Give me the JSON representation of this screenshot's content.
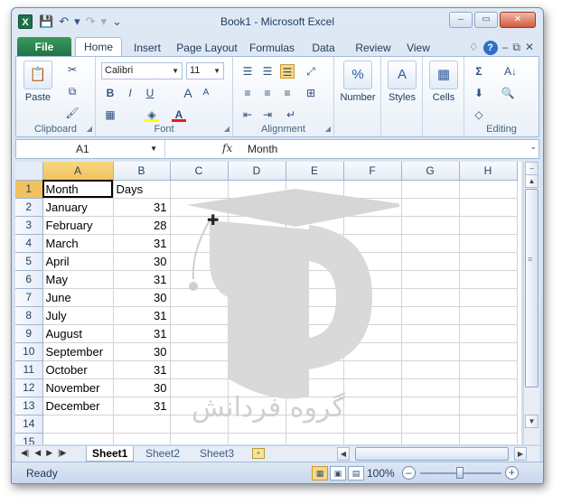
{
  "window": {
    "title": "Book1 - Microsoft Excel",
    "app_icon": "X",
    "buttons": {
      "minimize": "–",
      "restore": "▭",
      "close": "✕"
    }
  },
  "qat": {
    "save": "💾",
    "undo": "↶",
    "undo_drop": "▾",
    "redo": "↷",
    "redo_drop": "▾",
    "customize": "⌄"
  },
  "tabs": {
    "file": "File",
    "items": [
      "Home",
      "Insert",
      "Page Layout",
      "Formulas",
      "Data",
      "Review",
      "View"
    ],
    "active": "Home",
    "help": "?"
  },
  "ribbon": {
    "clipboard": {
      "label": "Clipboard",
      "paste": "Paste"
    },
    "font": {
      "label": "Font",
      "name": "Calibri",
      "size": "11",
      "bold": "B",
      "italic": "I",
      "underline": "U",
      "grow": "A",
      "shrink": "A"
    },
    "alignment": {
      "label": "Alignment"
    },
    "number": {
      "label": "Number",
      "icon": "%"
    },
    "styles": {
      "label": "Styles",
      "icon": "A"
    },
    "cells": {
      "label": "Cells",
      "icon": "▦"
    },
    "editing": {
      "label": "Editing",
      "sum": "Σ",
      "sort": "A↓",
      "find": "🔍"
    }
  },
  "formula_bar": {
    "name_box": "A1",
    "fx": "fx",
    "formula": "Month"
  },
  "grid": {
    "columns": [
      "A",
      "B",
      "C",
      "D",
      "E",
      "F",
      "G",
      "H"
    ],
    "rows": [
      [
        "Month",
        "Days"
      ],
      [
        "January",
        "31"
      ],
      [
        "February",
        "28"
      ],
      [
        "March",
        "31"
      ],
      [
        "April",
        "30"
      ],
      [
        "May",
        "31"
      ],
      [
        "June",
        "30"
      ],
      [
        "July",
        "31"
      ],
      [
        "August",
        "31"
      ],
      [
        "September",
        "30"
      ],
      [
        "October",
        "31"
      ],
      [
        "November",
        "30"
      ],
      [
        "December",
        "31"
      ],
      [
        "",
        ""
      ],
      [
        "",
        ""
      ]
    ],
    "row_numbers": [
      "1",
      "2",
      "3",
      "4",
      "5",
      "6",
      "7",
      "8",
      "9",
      "10",
      "11",
      "12",
      "13",
      "14",
      "15"
    ],
    "active_cell": "A1"
  },
  "watermark": {
    "text": "گروه فردانش"
  },
  "sheets": {
    "tabs": [
      "Sheet1",
      "Sheet2",
      "Sheet3"
    ],
    "active": "Sheet1"
  },
  "status": {
    "mode": "Ready",
    "zoom": "100%",
    "zoom_level": 1.0
  },
  "colors": {
    "file_tab": "#1e7145",
    "selection_header": "#f1c15f",
    "accent": "#2f6fc7"
  }
}
